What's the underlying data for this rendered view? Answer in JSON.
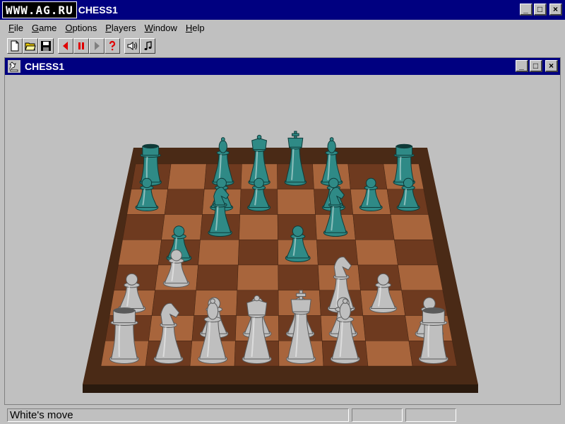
{
  "app": {
    "logo_text": "WWW.AG.RU",
    "title": "CHESS1"
  },
  "window_buttons": {
    "minimize": "_",
    "maximize": "□",
    "close": "×"
  },
  "menu": [
    {
      "accel": "F",
      "rest": "ile"
    },
    {
      "accel": "G",
      "rest": "ame"
    },
    {
      "accel": "O",
      "rest": "ptions"
    },
    {
      "accel": "P",
      "rest": "layers"
    },
    {
      "accel": "W",
      "rest": "indow"
    },
    {
      "accel": "H",
      "rest": "elp"
    }
  ],
  "toolbar": {
    "icons": [
      "new-file-icon",
      "open-folder-icon",
      "save-disk-icon",
      "back-arrow-icon",
      "pause-icon",
      "forward-arrow-icon",
      "help-question-icon",
      "speaker-icon",
      "music-note-icon"
    ]
  },
  "child_window": {
    "title": "CHESS1"
  },
  "board": {
    "colors": {
      "light": "#a8653c",
      "dark": "#6e3a1f",
      "frame": "#4a2a16",
      "frame_edge": "#2a1a0e",
      "black_pieces": "#2f8a86",
      "white_pieces": "#bfbfbf"
    },
    "pieces": [
      {
        "type": "rook",
        "color": "black",
        "square": "a8"
      },
      {
        "type": "bishop",
        "color": "black",
        "square": "c8"
      },
      {
        "type": "queen",
        "color": "black",
        "square": "d8"
      },
      {
        "type": "king",
        "color": "black",
        "square": "e8"
      },
      {
        "type": "bishop",
        "color": "black",
        "square": "f8"
      },
      {
        "type": "rook",
        "color": "black",
        "square": "h8"
      },
      {
        "type": "pawn",
        "color": "black",
        "square": "a7"
      },
      {
        "type": "pawn",
        "color": "black",
        "square": "c7"
      },
      {
        "type": "pawn",
        "color": "black",
        "square": "d7"
      },
      {
        "type": "pawn",
        "color": "black",
        "square": "f7"
      },
      {
        "type": "pawn",
        "color": "black",
        "square": "g7"
      },
      {
        "type": "pawn",
        "color": "black",
        "square": "h7"
      },
      {
        "type": "knight",
        "color": "black",
        "square": "c6"
      },
      {
        "type": "knight",
        "color": "black",
        "square": "f6"
      },
      {
        "type": "pawn",
        "color": "black",
        "square": "b5"
      },
      {
        "type": "pawn",
        "color": "black",
        "square": "e5"
      },
      {
        "type": "pawn",
        "color": "white",
        "square": "b4"
      },
      {
        "type": "knight",
        "color": "white",
        "square": "f3"
      },
      {
        "type": "pawn",
        "color": "white",
        "square": "a3"
      },
      {
        "type": "pawn",
        "color": "white",
        "square": "g3"
      },
      {
        "type": "pawn",
        "color": "white",
        "square": "c2"
      },
      {
        "type": "pawn",
        "color": "white",
        "square": "d2"
      },
      {
        "type": "pawn",
        "color": "white",
        "square": "e2"
      },
      {
        "type": "pawn",
        "color": "white",
        "square": "f2"
      },
      {
        "type": "pawn",
        "color": "white",
        "square": "h2"
      },
      {
        "type": "rook",
        "color": "white",
        "square": "a1"
      },
      {
        "type": "knight",
        "color": "white",
        "square": "b1"
      },
      {
        "type": "bishop",
        "color": "white",
        "square": "c1"
      },
      {
        "type": "queen",
        "color": "white",
        "square": "d1"
      },
      {
        "type": "king",
        "color": "white",
        "square": "e1"
      },
      {
        "type": "bishop",
        "color": "white",
        "square": "f1"
      },
      {
        "type": "rook",
        "color": "white",
        "square": "h1"
      }
    ]
  },
  "status": {
    "message": "White's move",
    "pane2": "",
    "pane3": ""
  }
}
